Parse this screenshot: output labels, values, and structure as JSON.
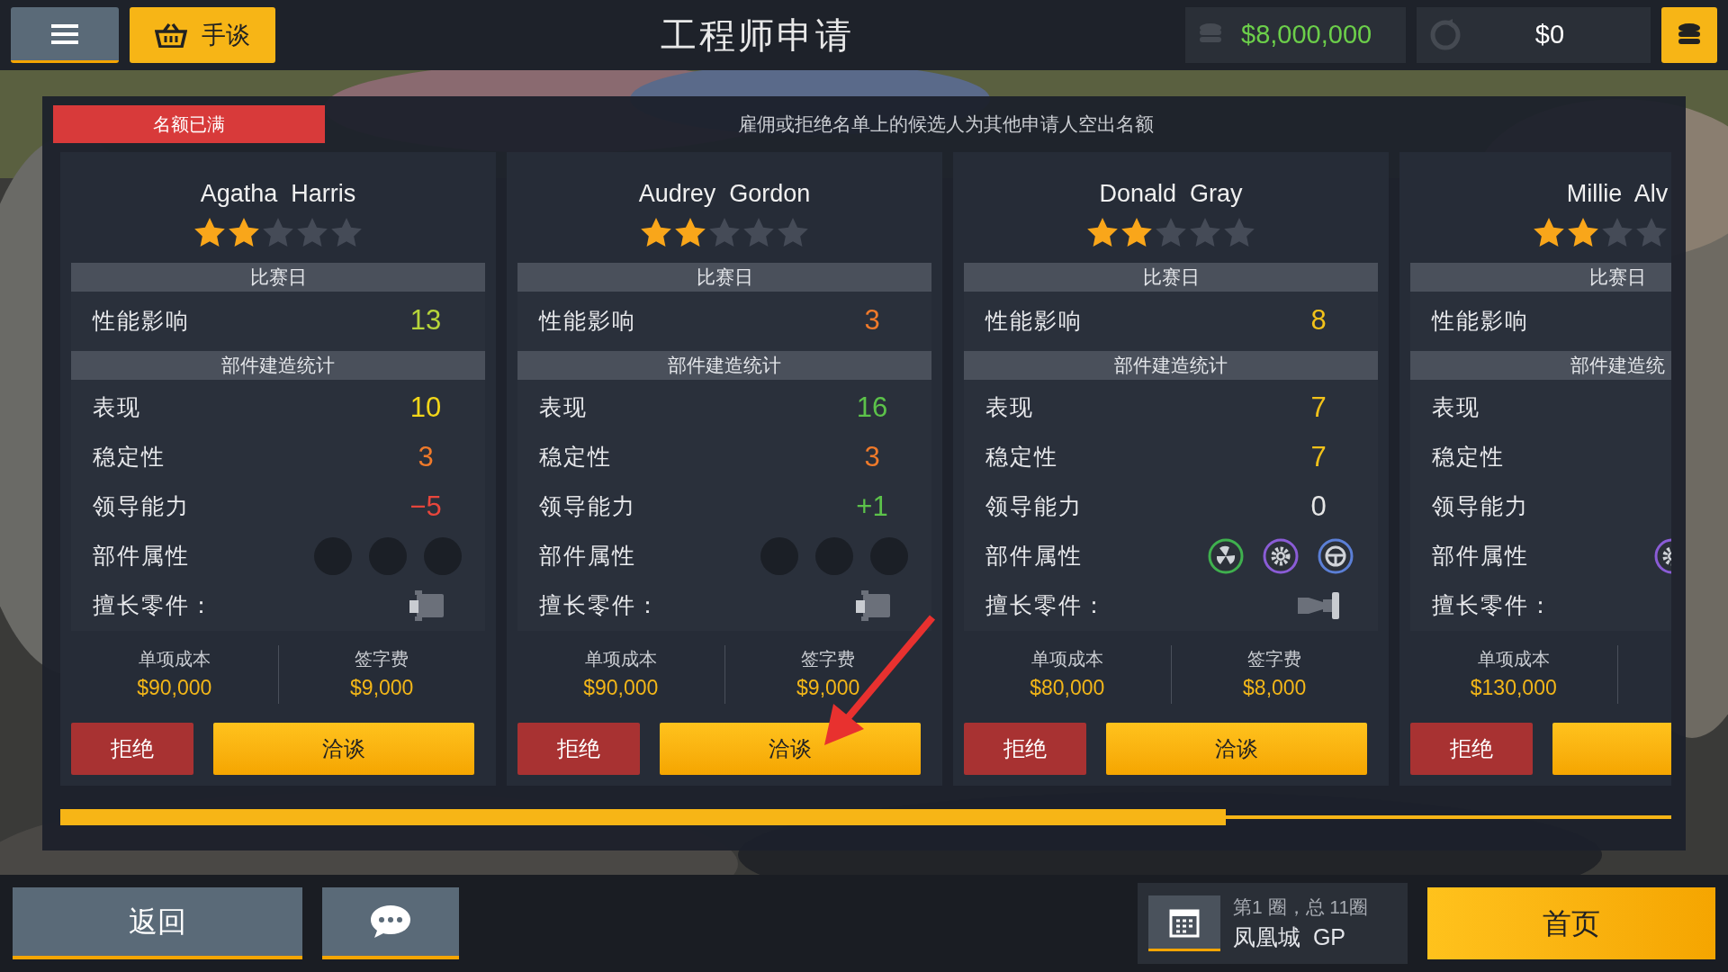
{
  "top_bar": {
    "shop_button": "手谈",
    "title": "工程师申请",
    "money": "$8,000,000",
    "credits": "$0"
  },
  "banner": {
    "badge": "名额已满",
    "message": "雇佣或拒绝名单上的候选人为其他申请人空出名额"
  },
  "candidates": [
    {
      "name": "Agatha  Harris",
      "stars": 2,
      "cut_off": false,
      "race_header": "比赛日",
      "impact": {
        "label": "性能影响",
        "value": "13",
        "color": "#b6d43a"
      },
      "build_header": "部件建造统计",
      "stats": [
        {
          "label": "表现",
          "value": "10",
          "color": "#f2d619"
        },
        {
          "label": "稳定性",
          "value": "3",
          "color": "#f07a2a"
        },
        {
          "label": "领导能力",
          "value": "−5",
          "color": "#e8463c"
        }
      ],
      "parts_label": "部件属性",
      "parts": [
        {
          "kind": "empty"
        },
        {
          "kind": "empty"
        },
        {
          "kind": "empty"
        }
      ],
      "specialty_label": "擅长零件：",
      "specialty": {
        "kind": "block"
      },
      "cost_label": "单项成本",
      "cost": "$90,000",
      "fee_label": "签字费",
      "fee": "$9,000",
      "reject": "拒绝",
      "negotiate": "洽谈"
    },
    {
      "name": "Audrey  Gordon",
      "stars": 2,
      "cut_off": false,
      "race_header": "比赛日",
      "impact": {
        "label": "性能影响",
        "value": "3",
        "color": "#f07a2a"
      },
      "build_header": "部件建造统计",
      "stats": [
        {
          "label": "表现",
          "value": "16",
          "color": "#5cc24a"
        },
        {
          "label": "稳定性",
          "value": "3",
          "color": "#f07a2a"
        },
        {
          "label": "领导能力",
          "value": "+1",
          "color": "#5cc24a"
        }
      ],
      "parts_label": "部件属性",
      "parts": [
        {
          "kind": "empty"
        },
        {
          "kind": "empty"
        },
        {
          "kind": "empty"
        }
      ],
      "specialty_label": "擅长零件：",
      "specialty": {
        "kind": "block"
      },
      "cost_label": "单项成本",
      "cost": "$90,000",
      "fee_label": "签字费",
      "fee": "$9,000",
      "reject": "拒绝",
      "negotiate": "洽谈"
    },
    {
      "name": "Donald  Gray",
      "stars": 2,
      "cut_off": false,
      "race_header": "比赛日",
      "impact": {
        "label": "性能影响",
        "value": "8",
        "color": "#f2c21a"
      },
      "build_header": "部件建造统计",
      "stats": [
        {
          "label": "表现",
          "value": "7",
          "color": "#f2c21a"
        },
        {
          "label": "稳定性",
          "value": "7",
          "color": "#f2c21a"
        },
        {
          "label": "领导能力",
          "value": "0",
          "color": "#e6e6e6"
        }
      ],
      "parts_label": "部件属性",
      "parts": [
        {
          "kind": "fan"
        },
        {
          "kind": "gear"
        },
        {
          "kind": "steering"
        }
      ],
      "specialty_label": "擅长零件：",
      "specialty": {
        "kind": "car"
      },
      "cost_label": "单项成本",
      "cost": "$80,000",
      "fee_label": "签字费",
      "fee": "$8,000",
      "reject": "拒绝",
      "negotiate": "洽谈"
    },
    {
      "name": "Millie  Alv",
      "stars": 2,
      "cut_off": true,
      "race_header": "比赛日",
      "impact": {
        "label": "性能影响"
      },
      "build_header": "部件建造统",
      "stats": [
        {
          "label": "表现"
        },
        {
          "label": "稳定性"
        },
        {
          "label": "领导能力"
        }
      ],
      "parts_label": "部件属性",
      "parts": [
        {
          "kind": "gear"
        }
      ],
      "specialty_label": "擅长零件：",
      "cost_label": "单项成本",
      "cost": "$130,000",
      "reject": "拒绝"
    }
  ],
  "bottom_bar": {
    "back": "返回",
    "lap": "第1 圈，总 11圈",
    "race": "凤凰城  GP",
    "home": "首页"
  }
}
